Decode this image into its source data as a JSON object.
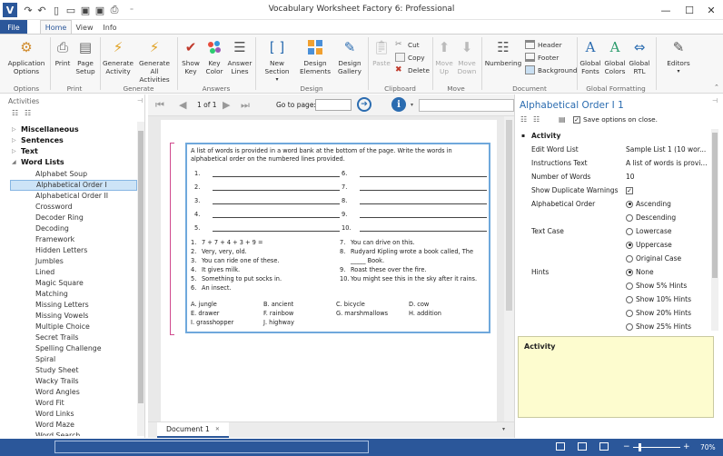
{
  "window": {
    "title": "Vocabulary Worksheet Factory 6: Professional",
    "controls": {
      "minimize": "—",
      "maximize": "☐",
      "close": "✕"
    }
  },
  "quick_access": {
    "items": [
      "redo-icon",
      "undo-icon",
      "new-icon",
      "open-icon",
      "save-icon",
      "save-as-icon",
      "print-icon"
    ]
  },
  "tabs": [
    "File",
    "Home",
    "View",
    "Info"
  ],
  "ribbon": {
    "options": {
      "application_options": "Application Options",
      "group": "Options"
    },
    "print": {
      "print": "Print",
      "page_setup": "Page Setup",
      "group": "Print"
    },
    "generate": {
      "generate_activity": "Generate Activity",
      "generate_all": "Generate All Activities",
      "group": "Generate"
    },
    "answers": {
      "show_key": "Show Key",
      "key_color": "Key Color",
      "answer_lines": "Answer Lines",
      "group": "Answers"
    },
    "design": {
      "new_section": "New Section",
      "design_elements": "Design Elements",
      "design_gallery": "Design Gallery",
      "group": "Design"
    },
    "clipboard": {
      "paste": "Paste",
      "cut": "Cut",
      "copy": "Copy",
      "delete": "Delete",
      "group": "Clipboard"
    },
    "move": {
      "move_up": "Move Up",
      "move_down": "Move Down",
      "group": "Move"
    },
    "document": {
      "numbering": "Numbering",
      "header": "Header",
      "footer": "Footer",
      "background": "Background",
      "group": "Document"
    },
    "global_formatting": {
      "fonts": "Global Fonts",
      "colors": "Global Colors",
      "rtl": "Global RTL",
      "group": "Global Formatting"
    },
    "editors": {
      "editors": "Editors"
    }
  },
  "activities_panel": {
    "title": "Activities",
    "categories": [
      "Miscellaneous",
      "Sentences",
      "Text",
      "Word Lists"
    ],
    "word_lists": [
      "Alphabet Soup",
      "Alphabetical Order I",
      "Alphabetical Order II",
      "Crossword",
      "Decoder Ring",
      "Decoding",
      "Framework",
      "Hidden Letters",
      "Jumbles",
      "Lined",
      "Magic Square",
      "Matching",
      "Missing Letters",
      "Missing Vowels",
      "Multiple Choice",
      "Secret Trails",
      "Spelling Challenge",
      "Spiral",
      "Study Sheet",
      "Wacky Trails",
      "Word Angles",
      "Word Fit",
      "Word Links",
      "Word Maze",
      "Word Search"
    ],
    "selected": "Alphabetical Order I"
  },
  "navigation": {
    "page_indicator": "1 of 1",
    "go_to_label": "Go to page:",
    "go_to_value": ""
  },
  "worksheet": {
    "instructions": "A list of words is provided in a word bank at the bottom of the page. Write the words in alphabetical order on the numbered lines provided.",
    "blank_numbers_left": [
      "1.",
      "2.",
      "3.",
      "4.",
      "5."
    ],
    "blank_numbers_right": [
      "6.",
      "7.",
      "8.",
      "9.",
      "10."
    ],
    "clues_left": [
      {
        "n": "1.",
        "t": "7 + 7 + 4 + 3 + 9 ="
      },
      {
        "n": "2.",
        "t": "Very, very, old."
      },
      {
        "n": "3.",
        "t": "You can ride one of these."
      },
      {
        "n": "4.",
        "t": "It gives milk."
      },
      {
        "n": "5.",
        "t": "Something to put socks in."
      },
      {
        "n": "6.",
        "t": "An insect."
      }
    ],
    "clues_right": [
      {
        "n": "7.",
        "t": "You can drive on this."
      },
      {
        "n": "8.",
        "t": "Rudyard Kipling wrote a book called, The"
      },
      {
        "n": "",
        "t": "_____ Book."
      },
      {
        "n": "9.",
        "t": "Roast these over the fire."
      },
      {
        "n": "10.",
        "t": "You might see this in the sky after it rains."
      }
    ],
    "word_bank": [
      [
        "A. jungle",
        "B. ancient",
        "C. bicycle",
        "D. cow"
      ],
      [
        "E. drawer",
        "F. rainbow",
        "G. marshmallows",
        "H. addition"
      ],
      [
        "I. grasshopper",
        "J. highway",
        "",
        ""
      ]
    ]
  },
  "document_tab": "Document 1",
  "properties_panel": {
    "title": "Alphabetical Order I 1",
    "save_options_label": "Save options on close.",
    "save_options_checked": true,
    "section": "Activity",
    "rows": [
      {
        "key": "Edit Word List",
        "value": "Sample List 1 (10 wor..."
      },
      {
        "key": "Instructions Text",
        "value": "A list of words is provi..."
      },
      {
        "key": "Number of Words",
        "value": "10"
      },
      {
        "key": "Show Duplicate Warnings",
        "value": "✓"
      }
    ],
    "alphabetical_order": {
      "label": "Alphabetical Order",
      "options": [
        "Ascending",
        "Descending"
      ],
      "selected": "Ascending"
    },
    "text_case": {
      "label": "Text Case",
      "options": [
        "Lowercase",
        "Uppercase",
        "Original Case"
      ],
      "selected": "Uppercase"
    },
    "hints": {
      "label": "Hints",
      "options": [
        "None",
        "Show 5% Hints",
        "Show 10% Hints",
        "Show 20% Hints",
        "Show 25% Hints"
      ],
      "selected": "None"
    },
    "description_title": "Activity"
  },
  "status_bar": {
    "zoom": "70%"
  },
  "colors": {
    "accent": "#2b579a",
    "selection": "#cde4f7",
    "description_bg": "#fdfccf",
    "worksheet_border": "#6fa8dc"
  }
}
